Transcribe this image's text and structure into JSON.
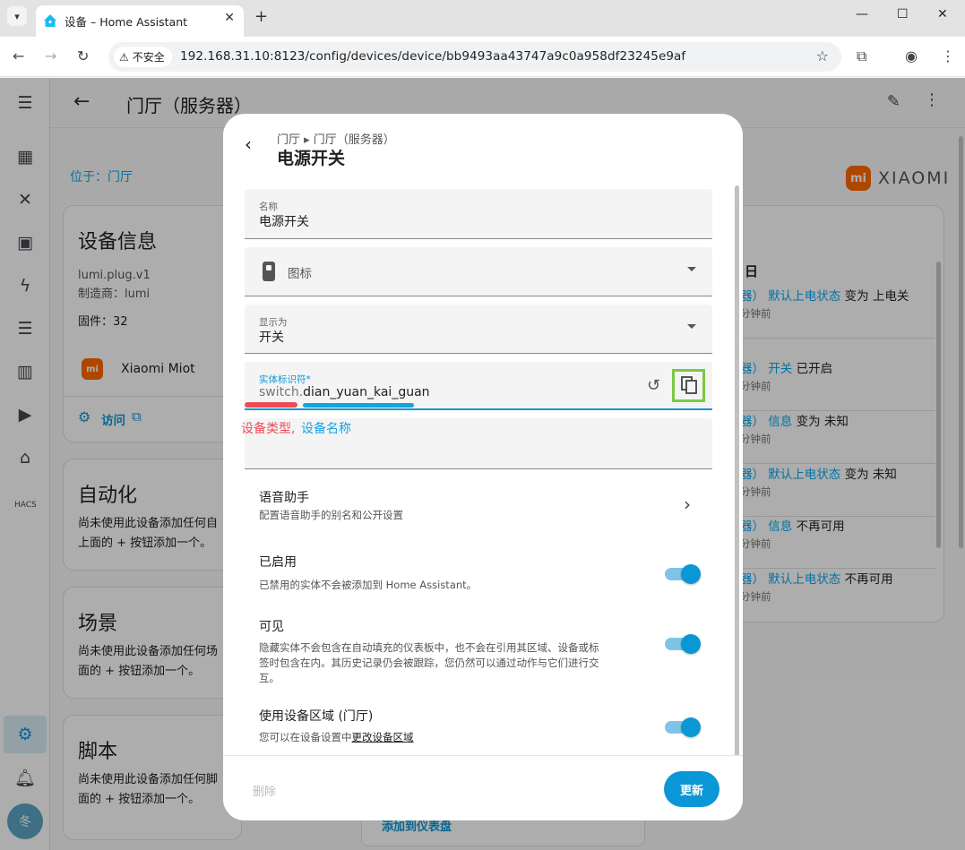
{
  "browser": {
    "tab_title": "设备 – Home Assistant",
    "insecure_label": "不安全",
    "url": "192.168.31.10:8123/config/devices/device/bb9493aa43747a9c0a958df23245e9af"
  },
  "header": {
    "title": "门厅（服务器）"
  },
  "area": {
    "link": "位于：门厅"
  },
  "xiaomi": {
    "badge": "mi",
    "text": "XIAOMI"
  },
  "device_info": {
    "title": "设备信息",
    "model": "lumi.plug.v1",
    "manufacturer": "制造商：lumi",
    "firmware": "固件：32",
    "integration": "Xiaomi Miot",
    "visit": "访问"
  },
  "automation": {
    "title": "自动化",
    "text_line1": "尚未使用此设备添加任何自",
    "text_line2": "上面的 + 按钮添加一个。"
  },
  "scene": {
    "title": "场景",
    "text_line1": "尚未使用此设备添加任何场",
    "text_line2": "面的 + 按钮添加一个。"
  },
  "script": {
    "title": "脚本",
    "text_line1": "尚未使用此设备添加任何脚",
    "text_line2": "面的 + 按钮添加一个。"
  },
  "add_dashboard": "添加到仪表盘",
  "logbook": {
    "title": "日",
    "rows": [
      {
        "prefix": "器）",
        "entity": "默认上电状态",
        "change": "变为 上电关",
        "time": "分钟前"
      },
      {
        "prefix": "器）",
        "entity": "开关",
        "change": "已开启",
        "time": "分钟前"
      },
      {
        "prefix": "器）",
        "entity": "信息",
        "change": "变为 未知",
        "time": "分钟前"
      },
      {
        "prefix": "器）",
        "entity": "默认上电状态",
        "change": "变为 未知",
        "time": "分钟前"
      },
      {
        "prefix": "器）",
        "entity": "信息",
        "change": "不再可用",
        "time": "分钟前"
      },
      {
        "prefix": "器）",
        "entity": "默认上电状态",
        "change": "不再可用",
        "time": "分钟前"
      }
    ]
  },
  "dialog": {
    "breadcrumb": "门厅 ▸ 门厅（服务器）",
    "title": "电源开关",
    "name_label": "名称",
    "name_value": "电源开关",
    "icon_label": "图标",
    "show_as_label": "显示为",
    "show_as_value": "开关",
    "entity_id_label": "实体标识符*",
    "entity_id_prefix": "switch.",
    "entity_id_value": "dian_yuan_kai_guan",
    "annotation_type": "设备类型,",
    "annotation_name": "设备名称",
    "voice_title": "语音助手",
    "voice_desc": "配置语音助手的别名和公开设置",
    "enabled_title": "已启用",
    "enabled_desc": "已禁用的实体不会被添加到 Home Assistant。",
    "visible_title": "可见",
    "visible_desc_1": "隐藏实体不会包含在自动填充的仪表板中，也不会在引用其区域、设备或标",
    "visible_desc_2": "签时包含在内。其历史记录仍会被跟踪，您仍然可以通过动作与它们进行交",
    "visible_desc_3": "互。",
    "area_title": "使用设备区域 (门厅)",
    "area_desc_prefix": "您可以在设备设置中",
    "area_desc_link": "更改设备区域",
    "delete": "删除",
    "update": "更新"
  },
  "sidebar": {
    "avatar": "冬",
    "hacs": "HACS"
  }
}
